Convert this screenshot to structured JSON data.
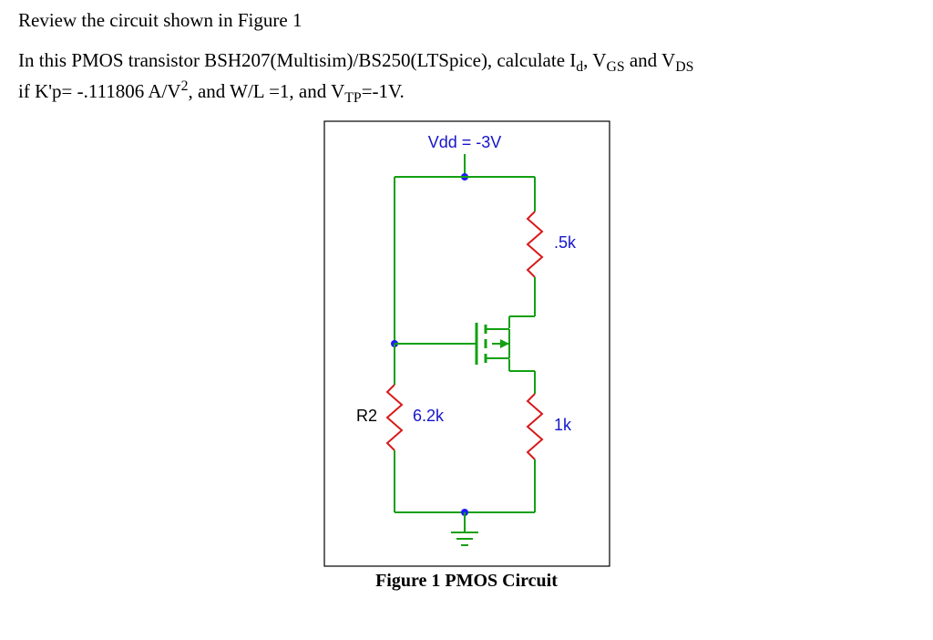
{
  "intro": "Review the circuit shown in Figure 1",
  "problem_line1_a": "In this PMOS transistor BSH207(Multisim)/BS250(LTSpice), calculate I",
  "problem_line1_b": ", V",
  "problem_line1_c": " and V",
  "problem_line2_a": "if K'p= -.111806 A/V",
  "problem_line2_b": ", and W/L =1,  and V",
  "problem_line2_c": "=-1V.",
  "sub_d": "d",
  "sub_GS": "GS",
  "sub_DS": "DS",
  "sup_2": "2",
  "sub_TP": "TP",
  "circuit": {
    "vdd_label": "Vdd = -3V",
    "r_top_right": ".5k",
    "r_bottom_right": "1k",
    "r_bottom_left_name": "R2",
    "r_bottom_left_val": "6.2k"
  },
  "caption": "Figure 1 PMOS Circuit",
  "chart_data": {
    "type": "circuit",
    "supply": {
      "name": "Vdd",
      "value_V": -3
    },
    "components": [
      {
        "ref": "R_top_right",
        "type": "resistor",
        "value_kohm": 0.5,
        "from": "Vdd",
        "to": "source"
      },
      {
        "ref": "R_bottom_right",
        "type": "resistor",
        "value_kohm": 1,
        "from": "drain",
        "to": "GND"
      },
      {
        "ref": "R2",
        "type": "resistor",
        "value_kohm": 6.2,
        "from": "gate",
        "to": "GND"
      },
      {
        "ref": "M1",
        "type": "PMOS",
        "model": "BSH207/BS250",
        "Kp_A_per_V2": -0.111806,
        "WL": 1,
        "Vtp_V": -1
      }
    ],
    "nets": {
      "Vdd": [
        "R_top_right.a",
        "gate_top_wire"
      ],
      "source": [
        "R_top_right.b",
        "M1.source"
      ],
      "drain": [
        "M1.drain",
        "R_bottom_right.a"
      ],
      "gate": [
        "M1.gate",
        "R2.a",
        "gate_top_wire"
      ],
      "GND": [
        "R2.b",
        "R_bottom_right.b"
      ]
    }
  }
}
